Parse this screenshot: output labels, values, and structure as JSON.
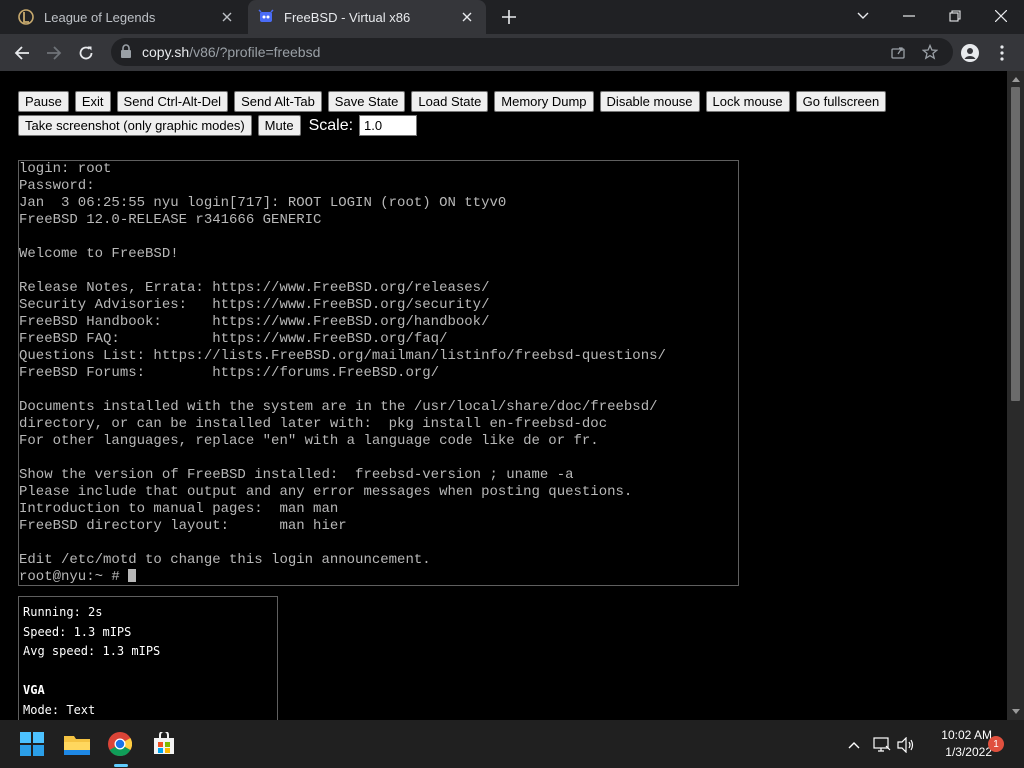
{
  "browser": {
    "tabs": [
      {
        "title": "League of Legends",
        "active": false,
        "icon": "league-of-legends-icon"
      },
      {
        "title": "FreeBSD - Virtual x86",
        "active": true,
        "icon": "v86-icon"
      }
    ],
    "url_host": "copy.sh",
    "url_path": "/v86/?profile=freebsd"
  },
  "controls": {
    "row1": [
      "Pause",
      "Exit",
      "Send Ctrl-Alt-Del",
      "Send Alt-Tab",
      "Save State",
      "Load State",
      "Memory Dump",
      "Disable mouse",
      "Lock mouse",
      "Go fullscreen"
    ],
    "row2": [
      "Take screenshot (only graphic modes)",
      "Mute"
    ],
    "scale_label": "Scale:",
    "scale_value": "1.0"
  },
  "terminal": {
    "lines": [
      "login: root",
      "Password:",
      "Jan  3 06:25:55 nyu login[717]: ROOT LOGIN (root) ON ttyv0",
      "FreeBSD 12.0-RELEASE r341666 GENERIC",
      "",
      "Welcome to FreeBSD!",
      "",
      "Release Notes, Errata: https://www.FreeBSD.org/releases/",
      "Security Advisories:   https://www.FreeBSD.org/security/",
      "FreeBSD Handbook:      https://www.FreeBSD.org/handbook/",
      "FreeBSD FAQ:           https://www.FreeBSD.org/faq/",
      "Questions List: https://lists.FreeBSD.org/mailman/listinfo/freebsd-questions/",
      "FreeBSD Forums:        https://forums.FreeBSD.org/",
      "",
      "Documents installed with the system are in the /usr/local/share/doc/freebsd/",
      "directory, or can be installed later with:  pkg install en-freebsd-doc",
      "For other languages, replace \"en\" with a language code like de or fr.",
      "",
      "Show the version of FreeBSD installed:  freebsd-version ; uname -a",
      "Please include that output and any error messages when posting questions.",
      "Introduction to manual pages:  man man",
      "FreeBSD directory layout:      man hier",
      "",
      "Edit /etc/motd to change this login announcement."
    ],
    "prompt": "root@nyu:~ # "
  },
  "info": {
    "running": "Running: 2s",
    "speed": "Speed: 1.3 mIPS",
    "avg_speed": "Avg speed: 1.3 mIPS",
    "vga_heading": "VGA",
    "mode": "Mode: Text"
  },
  "taskbar": {
    "time": "10:02 AM",
    "date": "1/3/2022",
    "notification_count": "1"
  },
  "colors": {
    "chrome_dark": "#202124",
    "chrome_toolbar": "#35363a",
    "terminal_text": "#b8b8b8",
    "notification_badge": "#e0503e"
  }
}
